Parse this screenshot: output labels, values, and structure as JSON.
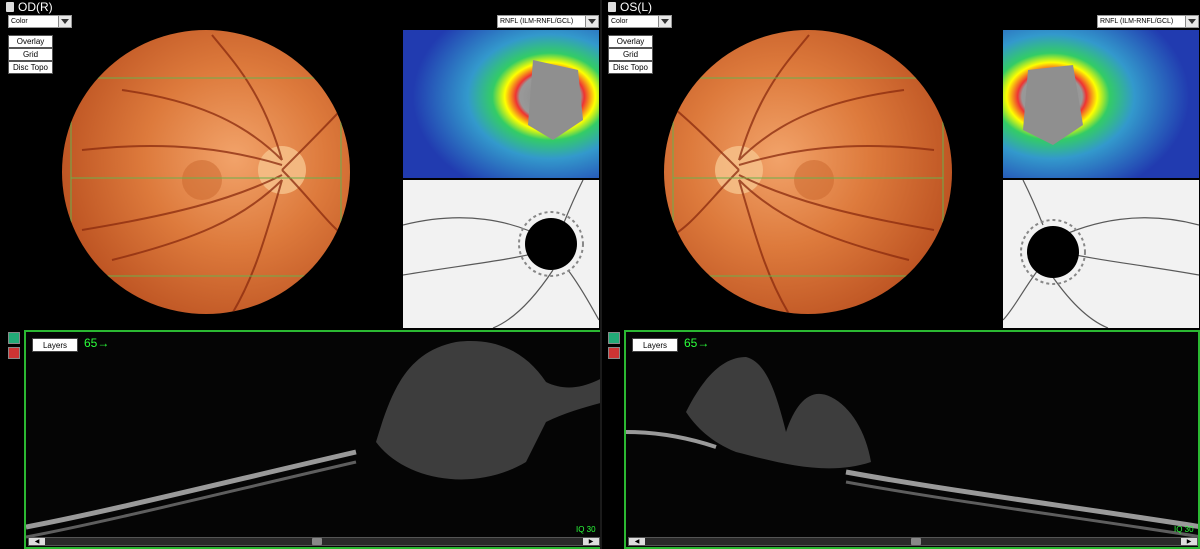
{
  "left": {
    "title": "OD(R)",
    "color_select": "Color",
    "map_select": "RNFL (ILM-RNFL/GCL)",
    "buttons": [
      "Overlay",
      "Grid",
      "Disc Topo"
    ],
    "layers_button": "Layers",
    "scan_number": "65→",
    "iq": "IQ 30"
  },
  "right": {
    "title": "OS(L)",
    "color_select": "Color",
    "map_select": "RNFL (ILM-RNFL/GCL)",
    "buttons": [
      "Overlay",
      "Grid",
      "Disc Topo"
    ],
    "layers_button": "Layers",
    "scan_number": "65→",
    "iq": "IQ 30"
  },
  "icons": [
    "document-icon",
    "dropdown-arrow-icon",
    "oct-tool-icon",
    "layer-tool-icon",
    "scroll-left-icon",
    "scroll-right-icon"
  ],
  "colors": {
    "accent_green": "#2bb832",
    "grid_green": "#6ab04c",
    "background": "#000000"
  }
}
